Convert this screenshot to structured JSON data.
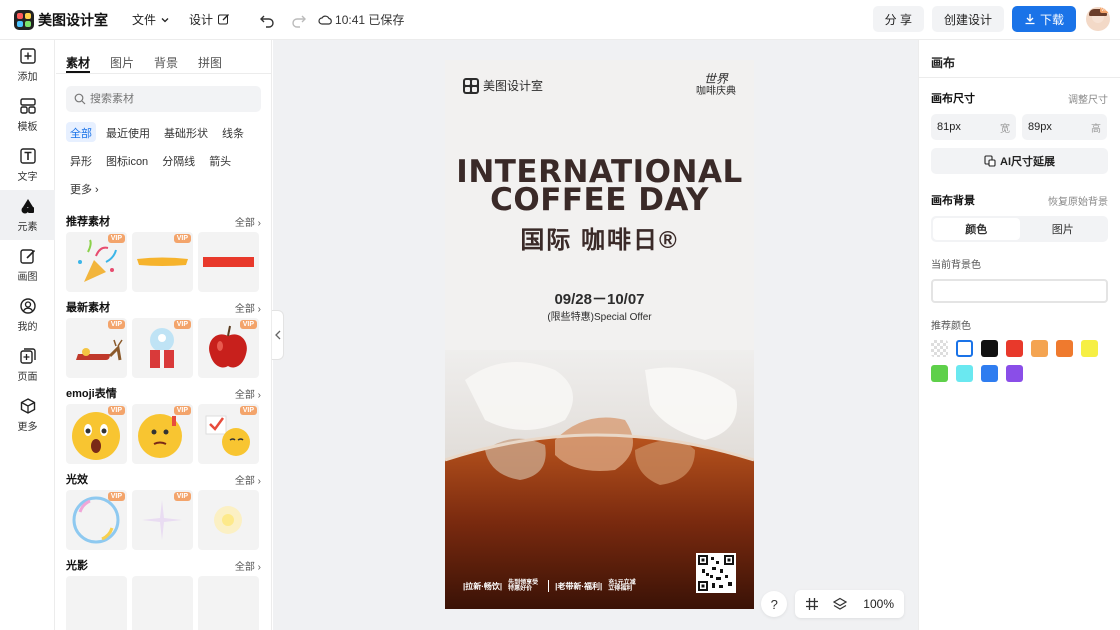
{
  "app": {
    "title": "美图设计室"
  },
  "topbar": {
    "file_menu": "文件",
    "design_menu": "设计",
    "save_status": "10:41 已保存",
    "share_label": "分 享",
    "create_label": "创建设计",
    "download_label": "下载",
    "avatar_badge": "VIP"
  },
  "rail": {
    "items": [
      {
        "label": "添加",
        "icon": "plus-square-icon"
      },
      {
        "label": "模板",
        "icon": "template-icon"
      },
      {
        "label": "文字",
        "icon": "text-icon"
      },
      {
        "label": "元素",
        "icon": "shapes-icon"
      },
      {
        "label": "画图",
        "icon": "pencil-icon"
      },
      {
        "label": "我的",
        "icon": "user-icon"
      },
      {
        "label": "页面",
        "icon": "page-add-icon"
      },
      {
        "label": "更多",
        "icon": "cube-icon"
      }
    ]
  },
  "panel": {
    "tabs": [
      "素材",
      "图片",
      "背景",
      "拼图"
    ],
    "search_placeholder": "搜索素材",
    "chips": [
      "全部",
      "最近使用",
      "基础形状",
      "线条",
      "异形",
      "图标icon",
      "分隔线",
      "箭头",
      "更多"
    ],
    "more_label": "全部",
    "vip_label": "VIP",
    "sections": [
      {
        "title": "推荐素材"
      },
      {
        "title": "最新素材"
      },
      {
        "title": "emoji表情"
      },
      {
        "title": "光效"
      },
      {
        "title": "光影"
      }
    ]
  },
  "poster": {
    "brand": "美图设计室",
    "badge_line1": "世界",
    "badge_line2": "咖啡庆典",
    "headline_line1": "INTERNATIONAL",
    "headline_line2": "COFFEE DAY",
    "subtitle": "国际  咖啡日®",
    "date": "09/28－10/07",
    "offer": "(限些特惠)Special Offer",
    "footer_1": "|拉新·畅饮|",
    "footer_2": "先到领享受 特惠好价",
    "footer_3": "|老带新·福利|",
    "footer_4": "充1元立减 立得福利"
  },
  "stage": {
    "zoom": "100%",
    "help": "?"
  },
  "rpanel": {
    "title": "画布",
    "size_label": "画布尺寸",
    "size_link": "调整尺寸",
    "width_value": "81px",
    "width_unit": "宽",
    "height_value": "89px",
    "height_unit": "高",
    "ai_button": "AI尺寸延展",
    "bg_label": "画布背景",
    "bg_link": "恢复原始背景",
    "seg_color": "颜色",
    "seg_image": "图片",
    "current_bg_label": "当前背景色",
    "recommend_label": "推荐颜色",
    "swatches": [
      "transparent",
      "#ffffff",
      "#111111",
      "#e8392b",
      "#f4a451",
      "#ef7a2e",
      "#f6ef44",
      "#5ed04a",
      "#6ae8f0",
      "#2f7df0",
      "#8a4ee8"
    ]
  }
}
